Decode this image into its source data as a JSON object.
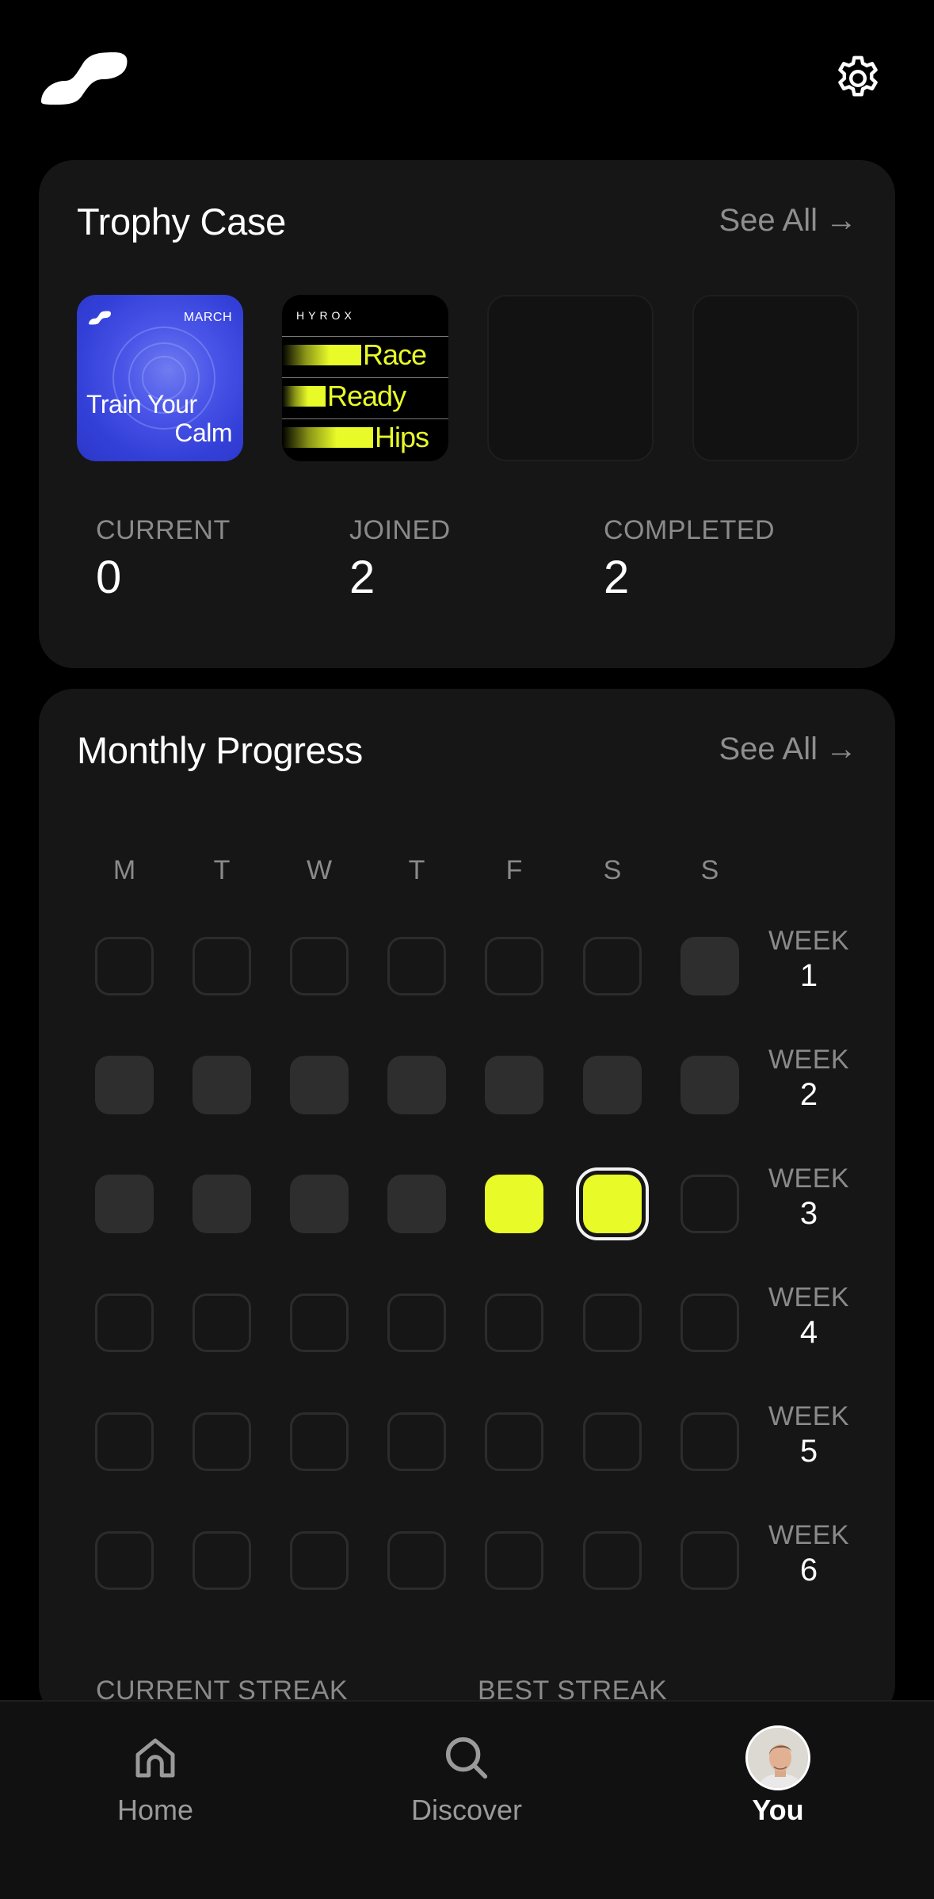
{
  "header": {
    "logo_icon": "brand-logo-icon",
    "settings_icon": "gear-icon"
  },
  "trophy_case": {
    "title": "Trophy Case",
    "see_all": "See All",
    "trophies": [
      {
        "name": "train-your-calm",
        "month": "MARCH",
        "line1": "Train Your",
        "line2": "Calm"
      },
      {
        "name": "hyrox-race-ready-hips",
        "brand": "HYROX",
        "words": [
          "Race",
          "Ready",
          "Hips"
        ]
      }
    ],
    "stats": [
      {
        "label": "CURRENT",
        "value": "0"
      },
      {
        "label": "JOINED",
        "value": "2"
      },
      {
        "label": "COMPLETED",
        "value": "2"
      }
    ]
  },
  "monthly_progress": {
    "title": "Monthly Progress",
    "see_all": "See All",
    "days": [
      "M",
      "T",
      "W",
      "T",
      "F",
      "S",
      "S"
    ],
    "week_label": "WEEK",
    "weeks": [
      {
        "number": "1",
        "cells": [
          "empty",
          "empty",
          "empty",
          "empty",
          "empty",
          "empty",
          "filled"
        ]
      },
      {
        "number": "2",
        "cells": [
          "filled",
          "filled",
          "filled",
          "filled",
          "filled",
          "filled",
          "filled"
        ]
      },
      {
        "number": "3",
        "cells": [
          "filled",
          "filled",
          "filled",
          "filled",
          "done",
          "today",
          "empty"
        ]
      },
      {
        "number": "4",
        "cells": [
          "empty",
          "empty",
          "empty",
          "empty",
          "empty",
          "empty",
          "empty"
        ]
      },
      {
        "number": "5",
        "cells": [
          "empty",
          "empty",
          "empty",
          "empty",
          "empty",
          "empty",
          "empty"
        ]
      },
      {
        "number": "6",
        "cells": [
          "empty",
          "empty",
          "empty",
          "empty",
          "empty",
          "empty",
          "empty"
        ]
      }
    ],
    "current_streak_label": "CURRENT STREAK",
    "best_streak_label": "BEST STREAK"
  },
  "tabbar": {
    "tabs": [
      {
        "label": "Home",
        "icon": "home-icon"
      },
      {
        "label": "Discover",
        "icon": "search-icon"
      },
      {
        "label": "You",
        "icon": "avatar"
      }
    ]
  },
  "colors": {
    "accent": "#e8fa28",
    "card": "#161616",
    "background": "#000000"
  }
}
